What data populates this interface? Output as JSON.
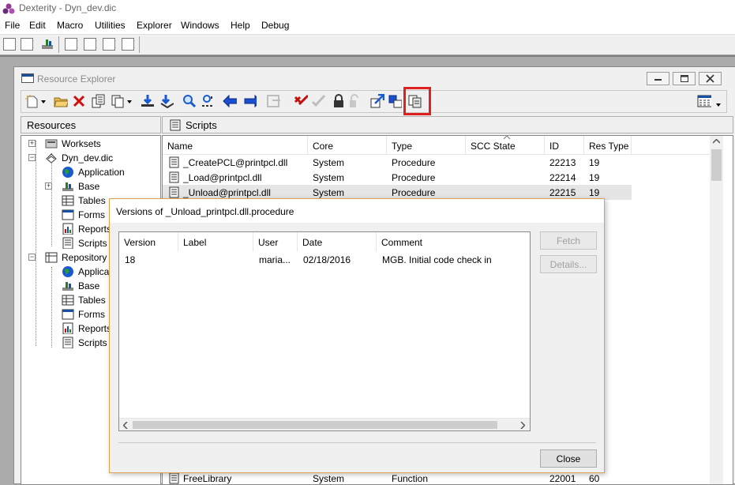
{
  "app": {
    "title": "Dexterity - Dyn_dev.dic",
    "menu": [
      "File",
      "Edit",
      "Macro",
      "Utilities",
      "Explorer",
      "Windows",
      "Help",
      "Debug"
    ]
  },
  "resource_explorer": {
    "title": "Resource Explorer",
    "resources_header": "Resources",
    "tree": [
      {
        "label": "Worksets",
        "icon": "worksets-icon"
      },
      {
        "label": "Dyn_dev.dic",
        "icon": "dictionary-icon"
      },
      {
        "label": "Application",
        "icon": "globe-icon"
      },
      {
        "label": "Base",
        "icon": "base-icon"
      },
      {
        "label": "Tables",
        "icon": "table-icon"
      },
      {
        "label": "Forms",
        "icon": "form-icon"
      },
      {
        "label": "Reports",
        "icon": "report-icon"
      },
      {
        "label": "Scripts",
        "icon": "script-icon"
      },
      {
        "label": "Repository -",
        "icon": "repository-icon"
      },
      {
        "label": "Applicati",
        "icon": "globe-icon"
      },
      {
        "label": "Base",
        "icon": "base-icon"
      },
      {
        "label": "Tables",
        "icon": "table-icon"
      },
      {
        "label": "Forms",
        "icon": "form-icon"
      },
      {
        "label": "Reports",
        "icon": "report-icon"
      },
      {
        "label": "Scripts",
        "icon": "script-icon"
      }
    ],
    "scripts_header": "Scripts",
    "columns": [
      "Name",
      "Core",
      "Type",
      "SCC State",
      "ID",
      "Res Type"
    ],
    "rows": [
      {
        "name": "_CreatePCL@printpcl.dll",
        "core": "System",
        "type": "Procedure",
        "scc": "",
        "id": "22213",
        "res_type": "19"
      },
      {
        "name": "_Load@printpcl.dll",
        "core": "System",
        "type": "Procedure",
        "scc": "",
        "id": "22214",
        "res_type": "19"
      },
      {
        "name": "_Unload@printpcl.dll",
        "core": "System",
        "type": "Procedure",
        "scc": "",
        "id": "22215",
        "res_type": "19"
      }
    ],
    "bottom_row": {
      "name": "FreeLibrary",
      "core": "System",
      "type": "Function",
      "id": "22001",
      "res_type": "60"
    }
  },
  "versions_dialog": {
    "title": "Versions of _Unload_printpcl.dll.procedure",
    "columns": [
      "Version",
      "Label",
      "User",
      "Date",
      "Comment"
    ],
    "rows": [
      {
        "version": "18",
        "label": "",
        "user": "maria...",
        "date": "02/18/2016",
        "comment": "MGB. Initial code check in"
      }
    ],
    "fetch_label": "Fetch",
    "details_label": "Details...",
    "close_label": "Close"
  },
  "colors": {
    "highlight": "#e0201e",
    "dialog_border": "#e0a24a",
    "selected_row": "#e5e5e5"
  }
}
